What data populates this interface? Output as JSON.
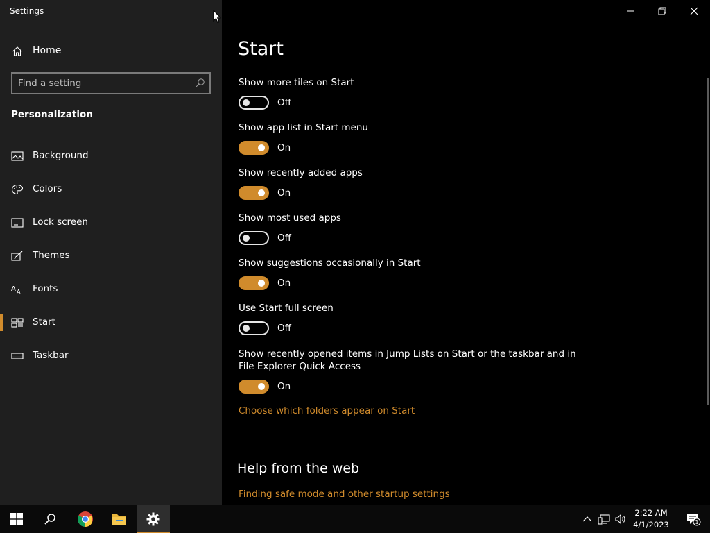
{
  "window": {
    "title": "Settings",
    "controls": [
      "minimize",
      "restore",
      "close"
    ]
  },
  "sidebar": {
    "home_label": "Home",
    "search_placeholder": "Find a setting",
    "section_title": "Personalization",
    "items": [
      {
        "label": "Background",
        "icon": "picture-icon",
        "selected": false
      },
      {
        "label": "Colors",
        "icon": "palette-icon",
        "selected": false
      },
      {
        "label": "Lock screen",
        "icon": "lock-screen-icon",
        "selected": false
      },
      {
        "label": "Themes",
        "icon": "brush-icon",
        "selected": false
      },
      {
        "label": "Fonts",
        "icon": "font-icon",
        "selected": false
      },
      {
        "label": "Start",
        "icon": "start-icon",
        "selected": true
      },
      {
        "label": "Taskbar",
        "icon": "taskbar-icon",
        "selected": false
      }
    ]
  },
  "main": {
    "title": "Start",
    "options": [
      {
        "label": "Show more tiles on Start",
        "state": "Off",
        "on": false
      },
      {
        "label": "Show app list in Start menu",
        "state": "On",
        "on": true
      },
      {
        "label": "Show recently added apps",
        "state": "On",
        "on": true
      },
      {
        "label": "Show most used apps",
        "state": "Off",
        "on": false
      },
      {
        "label": "Show suggestions occasionally in Start",
        "state": "On",
        "on": true
      },
      {
        "label": "Use Start full screen",
        "state": "Off",
        "on": false
      },
      {
        "label_line1": "Show recently opened items in Jump Lists on Start or the taskbar and in",
        "label_line2": "File Explorer Quick Access",
        "state": "On",
        "on": true
      }
    ],
    "folders_link": "Choose which folders appear on Start",
    "help_title": "Help from the web",
    "help_link": "Finding safe mode and other startup settings"
  },
  "taskbar": {
    "apps": [
      "windows-start-icon",
      "search-icon",
      "chrome-icon",
      "file-explorer-icon",
      "settings-gear-icon"
    ],
    "time": "2:22 AM",
    "date": "4/1/2023",
    "notification_count": "1"
  },
  "colors": {
    "accent": "#d08b2c",
    "sidebar_bg": "#1f1f1f",
    "main_bg": "#000000"
  }
}
